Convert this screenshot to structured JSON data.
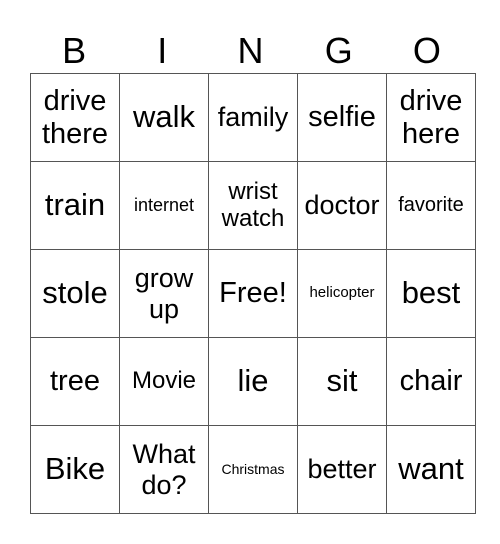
{
  "header": [
    "B",
    "I",
    "N",
    "G",
    "O"
  ],
  "rows": [
    [
      {
        "text": "drive there",
        "size": "s29"
      },
      {
        "text": "walk",
        "size": "s32"
      },
      {
        "text": "family",
        "size": "s27"
      },
      {
        "text": "selfie",
        "size": "s29"
      },
      {
        "text": "drive here",
        "size": "s29"
      }
    ],
    [
      {
        "text": "train",
        "size": "s32"
      },
      {
        "text": "internet",
        "size": "s18"
      },
      {
        "text": "wrist watch",
        "size": "s24"
      },
      {
        "text": "doctor",
        "size": "s27"
      },
      {
        "text": "favorite",
        "size": "s20"
      }
    ],
    [
      {
        "text": "stole",
        "size": "s32"
      },
      {
        "text": "grow up",
        "size": "s27"
      },
      {
        "text": "Free!",
        "size": "s29"
      },
      {
        "text": "helicopter",
        "size": "s15"
      },
      {
        "text": "best",
        "size": "s32"
      }
    ],
    [
      {
        "text": "tree",
        "size": "s29"
      },
      {
        "text": "Movie",
        "size": "s24"
      },
      {
        "text": "lie",
        "size": "s32"
      },
      {
        "text": "sit",
        "size": "s32"
      },
      {
        "text": "chair",
        "size": "s29"
      }
    ],
    [
      {
        "text": "Bike",
        "size": "s32"
      },
      {
        "text": "What do?",
        "size": "s27"
      },
      {
        "text": "Christmas",
        "size": "s14"
      },
      {
        "text": "better",
        "size": "s27"
      },
      {
        "text": "want",
        "size": "s32"
      }
    ]
  ]
}
